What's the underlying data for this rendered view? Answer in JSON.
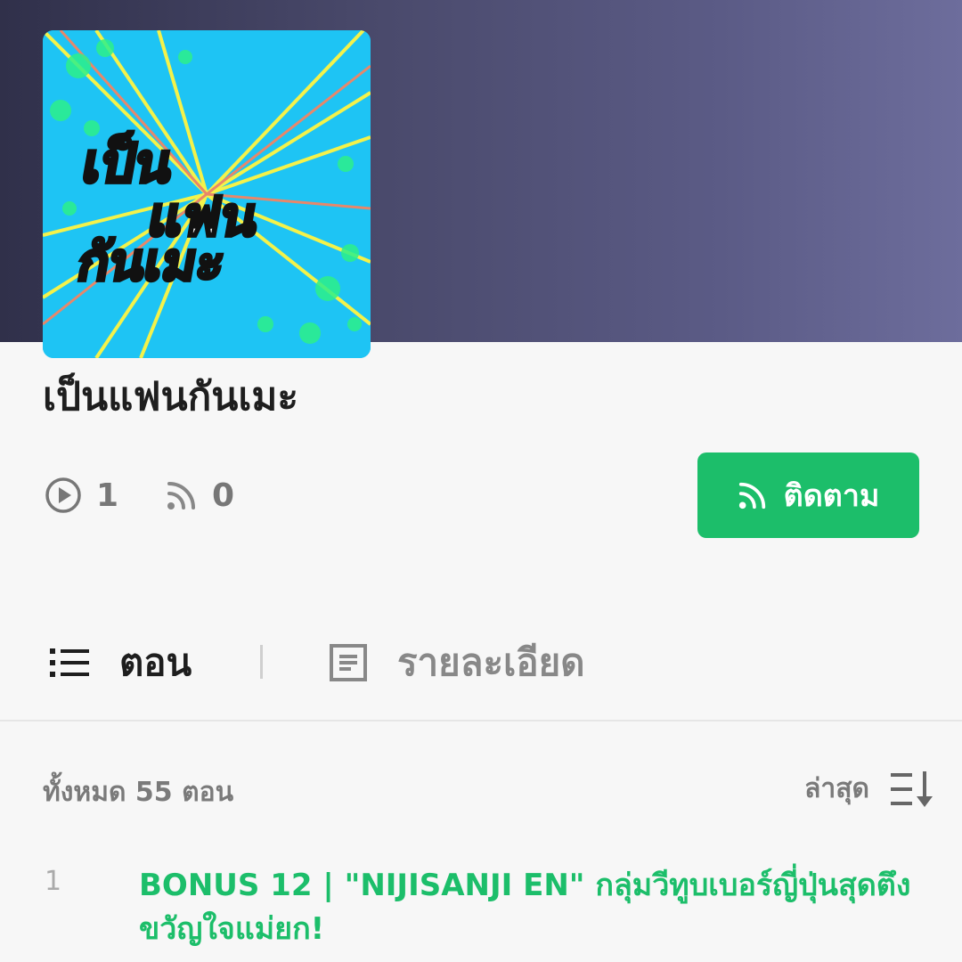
{
  "podcast": {
    "title": "เป็นแฟนกันเมะ",
    "cover_alt": "เป็นแฟนกันเมะ"
  },
  "stats": {
    "episodes": "1",
    "followers": "0"
  },
  "follow_button": {
    "label": "ติดตาม"
  },
  "tabs": [
    {
      "label": "ตอน",
      "active": true
    },
    {
      "label": "รายละเอียด",
      "active": false
    }
  ],
  "list": {
    "total_label": "ทั้งหมด 55 ตอน",
    "sort_label": "ล่าสุด"
  },
  "episodes": [
    {
      "number": "1",
      "title": "BONUS 12 | \"NIJISANJI EN\" กลุ่มวีทูบเบอร์ญี่ปุ่นสุดตึงขวัญใจแม่ยก!"
    }
  ],
  "colors": {
    "accent": "#1cbe6a",
    "hero_start": "#30304a",
    "hero_end": "#6d6d9c"
  }
}
